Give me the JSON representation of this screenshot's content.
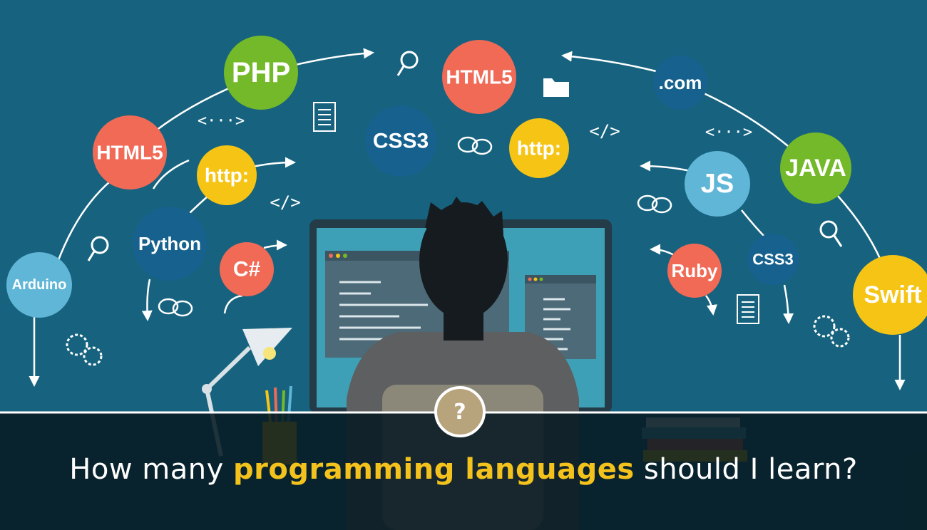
{
  "colors": {
    "background": "#17637f",
    "bubble_green": "#73b929",
    "bubble_red": "#f06a56",
    "bubble_blue": "#16618e",
    "bubble_light_blue": "#5fb6d7",
    "bubble_yellow": "#f5c414",
    "highlight": "#f3c21c"
  },
  "bubbles": [
    {
      "label": "PHP",
      "color": "green"
    },
    {
      "label": "HTML5",
      "color": "red"
    },
    {
      "label": "HTML5",
      "color": "red"
    },
    {
      "label": "CSS3",
      "color": "blue"
    },
    {
      "label": "http:",
      "color": "yellow"
    },
    {
      "label": "http:",
      "color": "yellow"
    },
    {
      "label": "Python",
      "color": "blue"
    },
    {
      "label": "C#",
      "color": "red"
    },
    {
      "label": "Arduino",
      "color": "light_blue"
    },
    {
      "label": ".com",
      "color": "blue"
    },
    {
      "label": "JAVA",
      "color": "green"
    },
    {
      "label": "JS",
      "color": "light_blue"
    },
    {
      "label": "CSS3",
      "color": "blue"
    },
    {
      "label": "Ruby",
      "color": "red"
    },
    {
      "label": "Swift",
      "color": "yellow"
    }
  ],
  "code_symbols": [
    "<···>",
    "</>",
    "</>",
    "<···>"
  ],
  "icons": [
    "search-icon",
    "folder-icon",
    "document-icon",
    "chat-icon",
    "gear-icon",
    "desk-lamp",
    "monitor",
    "programmer"
  ],
  "help_badge": "?",
  "caption": {
    "before": "How many ",
    "highlight": "programming languages",
    "after": " should I learn?"
  }
}
